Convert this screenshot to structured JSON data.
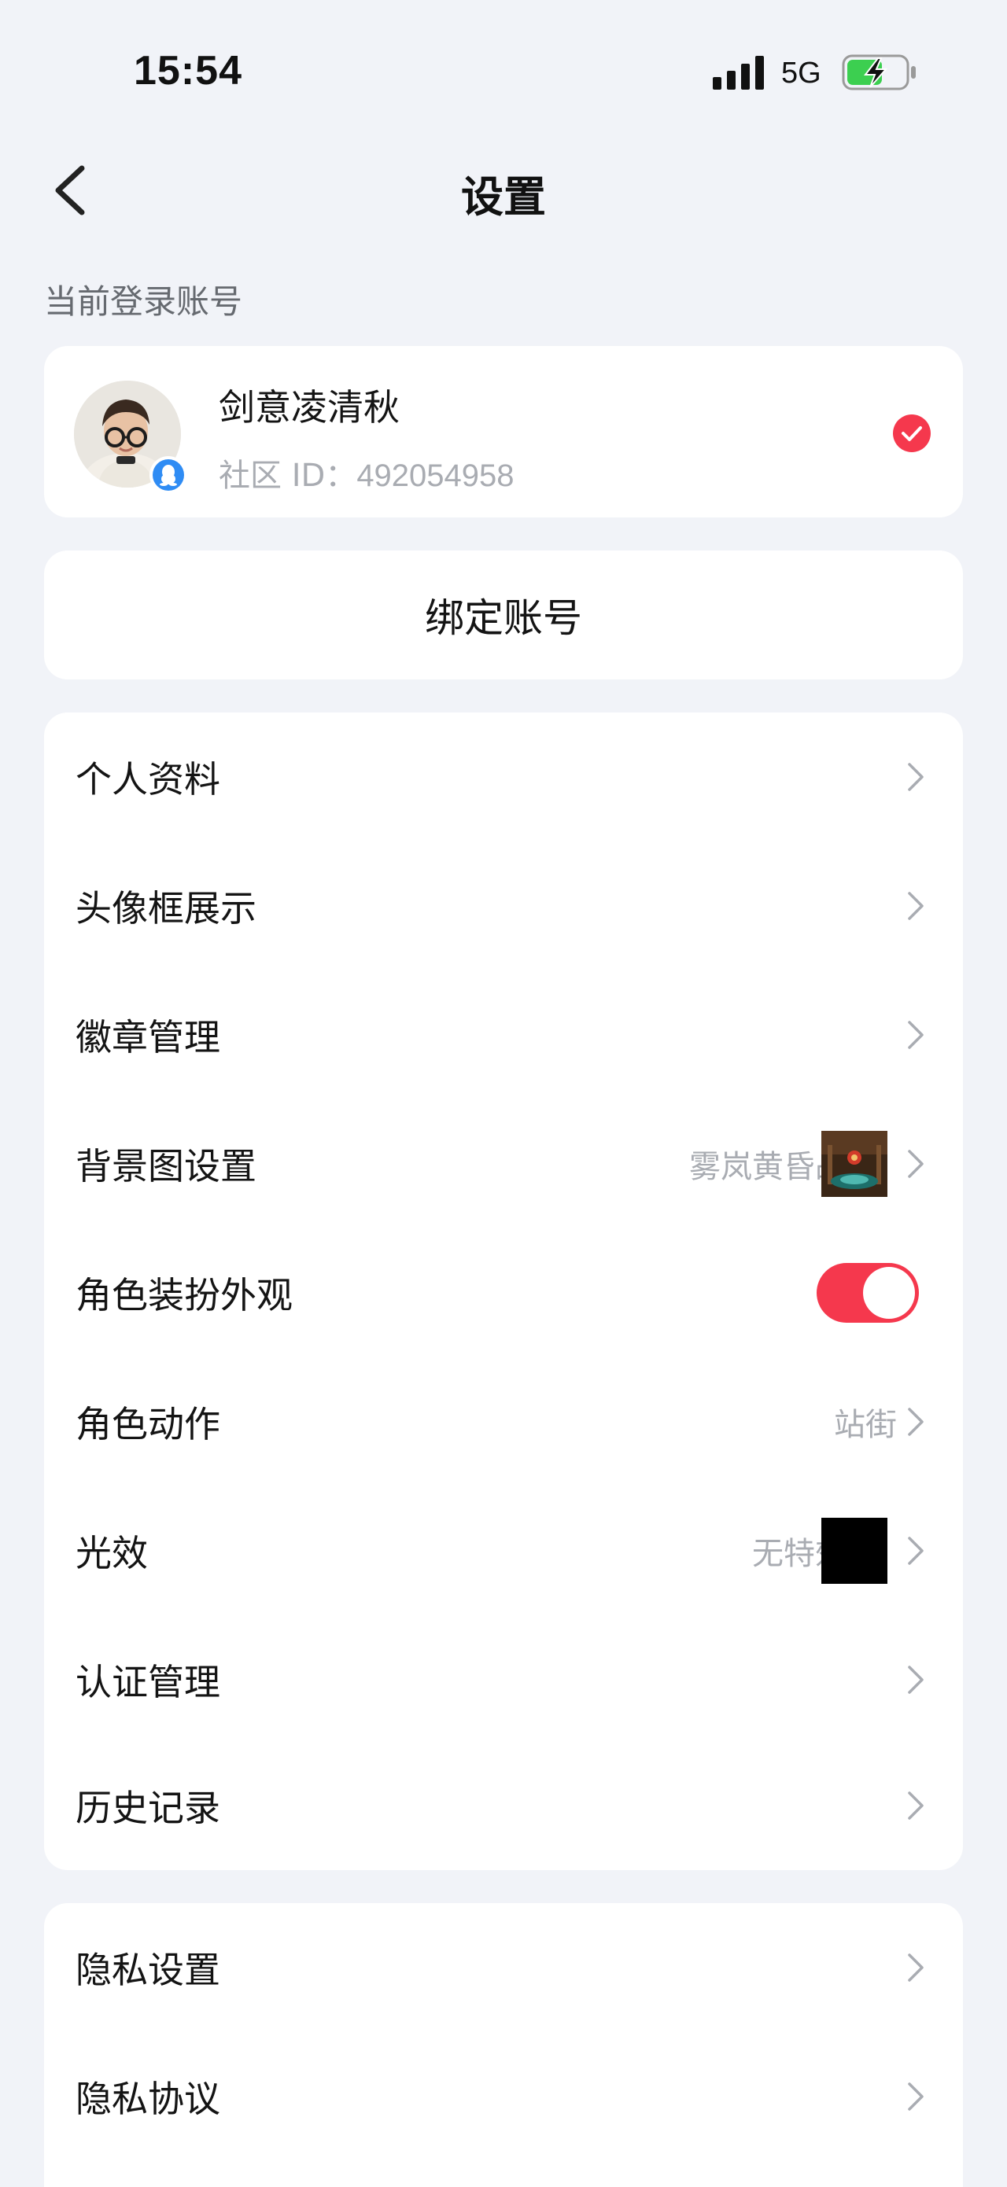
{
  "status_bar": {
    "time": "15:54",
    "network": "5G",
    "icons": [
      "signal-icon",
      "battery-charging-icon"
    ]
  },
  "nav": {
    "title": "设置",
    "back_icon": "chevron-left-icon"
  },
  "account_section_label": "当前登录账号",
  "account": {
    "name": "剑意凌清秋",
    "id_label": "社区 ID：",
    "id_value": "492054958",
    "badge_icon": "qq-icon",
    "selected_icon": "check-circle-icon"
  },
  "bind_button": "绑定账号",
  "settings_list": [
    {
      "label": "个人资料"
    },
    {
      "label": "头像框展示"
    },
    {
      "label": "徽章管理"
    },
    {
      "label": "背景图设置",
      "value": "雾岚黄昏战"
    },
    {
      "label": "角色装扮外观",
      "toggle_on": true
    },
    {
      "label": "角色动作",
      "value": "站街"
    },
    {
      "label": "光效",
      "value": "无特效"
    },
    {
      "label": "认证管理"
    },
    {
      "label": "历史记录"
    }
  ],
  "privacy_list": [
    {
      "label": "隐私设置"
    },
    {
      "label": "隐私协议"
    }
  ],
  "colors": {
    "background": "#f1f3f8",
    "card": "#ffffff",
    "accent_red": "#f5384d",
    "secondary_text": "#a9acb2",
    "qq_blue": "#2f8cf4"
  }
}
